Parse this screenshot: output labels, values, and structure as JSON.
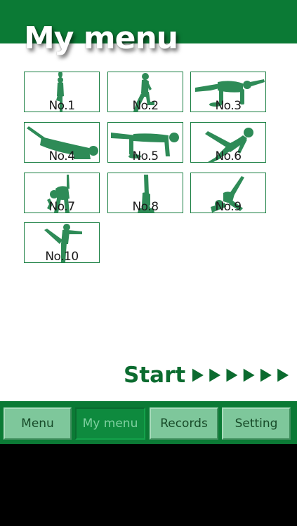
{
  "header": {
    "title": "My menu"
  },
  "exercises": [
    {
      "label": "No.1"
    },
    {
      "label": "No.2"
    },
    {
      "label": "No.3"
    },
    {
      "label": "No.4"
    },
    {
      "label": "No.5"
    },
    {
      "label": "No.6"
    },
    {
      "label": "No.7"
    },
    {
      "label": "No.8"
    },
    {
      "label": "No.9"
    },
    {
      "label": "No.10"
    }
  ],
  "start": {
    "label": "Start",
    "arrow_count": 6
  },
  "tabs": [
    {
      "label": "Menu",
      "active": false
    },
    {
      "label": "My menu",
      "active": true
    },
    {
      "label": "Records",
      "active": false
    },
    {
      "label": "Setting",
      "active": false
    }
  ],
  "colors": {
    "brand_green": "#0b7a35",
    "tab_idle": "#7ec79b",
    "tab_active": "#0e8a3e",
    "figure": "#2e8b57"
  },
  "icons": [
    "play-arrow-icon"
  ]
}
